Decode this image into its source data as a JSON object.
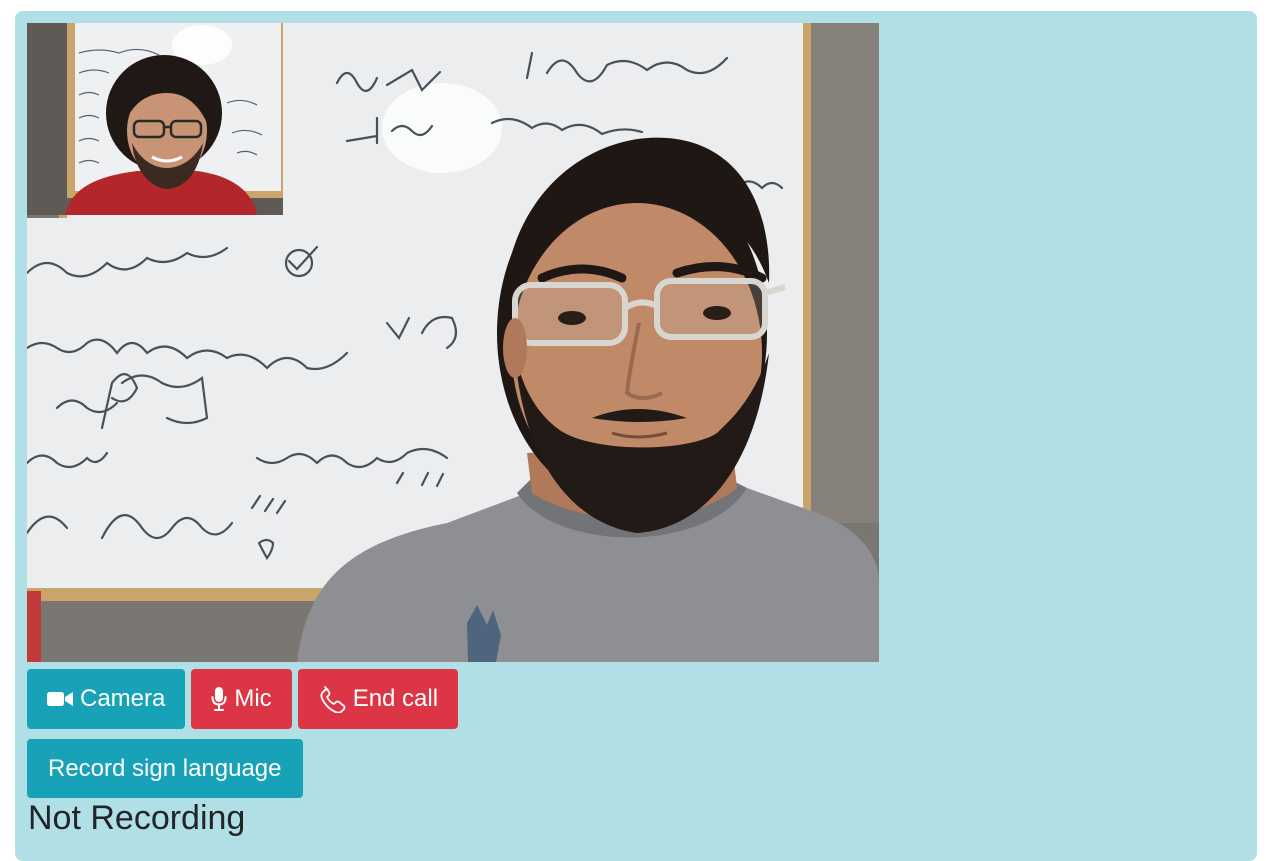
{
  "call": {
    "remote_video_label": "remote-participant-video",
    "local_video_label": "local-participant-video"
  },
  "controls": {
    "camera_label": "Camera",
    "mic_label": "Mic",
    "end_call_label": "End call",
    "camera_icon": "video-camera-icon",
    "mic_icon": "microphone-icon",
    "end_call_icon": "phone-icon"
  },
  "recording": {
    "button_label": "Record sign language",
    "status_text": "Not Recording"
  },
  "colors": {
    "panel_bg": "#b0dfe5",
    "info": "#17a2b8",
    "danger": "#dc3545",
    "status_text": "#212529"
  }
}
